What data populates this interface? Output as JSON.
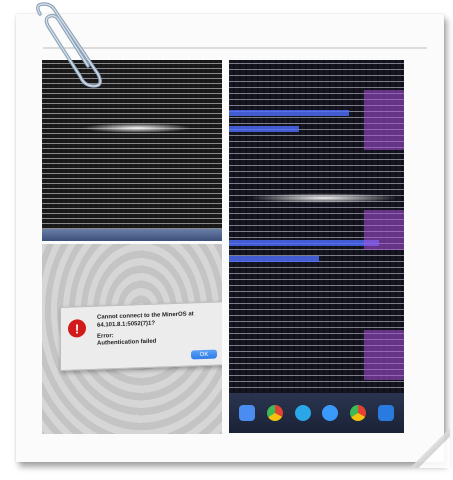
{
  "dialog": {
    "line1": "Cannot connect to the MinerOS at",
    "line2": "64.101.8.1:5052(7)1?",
    "line3": "Error:",
    "line4": "Authentication failed",
    "ok_label": "OK"
  },
  "icons": {
    "dock": [
      "finder-icon",
      "chrome-icon",
      "skype-icon",
      "safari-icon",
      "chrome-icon",
      "store-icon"
    ],
    "alert": "alert-icon",
    "paperclip": "paperclip-icon"
  },
  "colors": {
    "alert": "#d21a1a",
    "ok_button": "#2f7de8"
  }
}
